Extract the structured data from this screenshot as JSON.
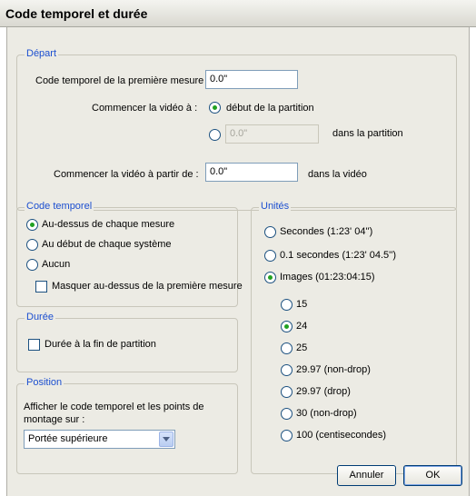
{
  "window": {
    "title": "Code temporel et durée"
  },
  "depart": {
    "legend": "Départ",
    "first_measure_label": "Code temporel de la première mesure",
    "first_measure_value": "0.0\"",
    "start_video_label": "Commencer la vidéo à :",
    "option_start": "début de la partition",
    "option_custom_value": "0.0\"",
    "option_custom_suffix": "dans la partition",
    "start_from_label": "Commencer la vidéo à partir de :",
    "start_from_value": "0.0\"",
    "start_from_suffix": "dans la vidéo"
  },
  "code_temporel": {
    "legend": "Code temporel",
    "options": [
      "Au-dessus de chaque mesure",
      "Au début de chaque système",
      "Aucun"
    ],
    "selected": 0,
    "hide_first_label": "Masquer au-dessus de la première mesure"
  },
  "duree": {
    "legend": "Durée",
    "end_label": "Durée à la fin de partition"
  },
  "position": {
    "legend": "Position",
    "label": "Afficher le code temporel et les points de montage sur :",
    "selected": "Portée supérieure"
  },
  "unites": {
    "legend": "Unités",
    "options": [
      "Secondes (1:23' 04'')",
      "0.1 secondes (1:23' 04.5'')",
      "Images (01:23:04:15)"
    ],
    "selected": 2,
    "frame_rates": [
      "15",
      "24",
      "25",
      "29.97 (non-drop)",
      "29.97 (drop)",
      "30 (non-drop)",
      "100 (centisecondes)"
    ],
    "frame_selected": 1
  },
  "buttons": {
    "cancel": "Annuler",
    "ok": "OK"
  }
}
